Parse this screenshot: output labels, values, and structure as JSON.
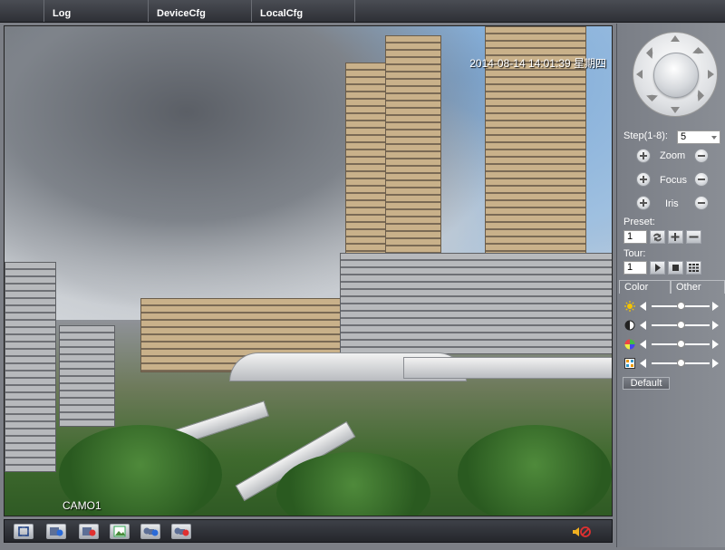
{
  "nav": {
    "tabs": [
      {
        "label": ""
      },
      {
        "label": "Log"
      },
      {
        "label": "DeviceCfg"
      },
      {
        "label": "LocalCfg"
      }
    ]
  },
  "video": {
    "timestamp": "2014-08-14 14:01:39 星期四",
    "camera_label": "CAMO1"
  },
  "toolbar": {
    "buttons": [
      {
        "name": "fullscreen"
      },
      {
        "name": "record-playback"
      },
      {
        "name": "record-stop"
      },
      {
        "name": "snapshot"
      },
      {
        "name": "video-start"
      },
      {
        "name": "video-stop"
      }
    ],
    "speaker": "speaker-muted-icon"
  },
  "ptz": {
    "step_label": "Step(1-8):",
    "step_value": "5",
    "zoom_label": "Zoom",
    "focus_label": "Focus",
    "iris_label": "Iris",
    "preset_label": "Preset:",
    "preset_value": "1",
    "tour_label": "Tour:",
    "tour_value": "1"
  },
  "image_settings": {
    "tabs": [
      {
        "label": "Color"
      },
      {
        "label": "Other"
      }
    ],
    "sliders": [
      {
        "name": "brightness",
        "level": 0.5
      },
      {
        "name": "contrast",
        "level": 0.5
      },
      {
        "name": "saturation",
        "level": 0.5
      },
      {
        "name": "hue",
        "level": 0.5
      }
    ],
    "default_label": "Default"
  },
  "colors": {
    "topbar": "#2e3036",
    "panel": "#84888f",
    "accent_white": "#ffffff"
  }
}
